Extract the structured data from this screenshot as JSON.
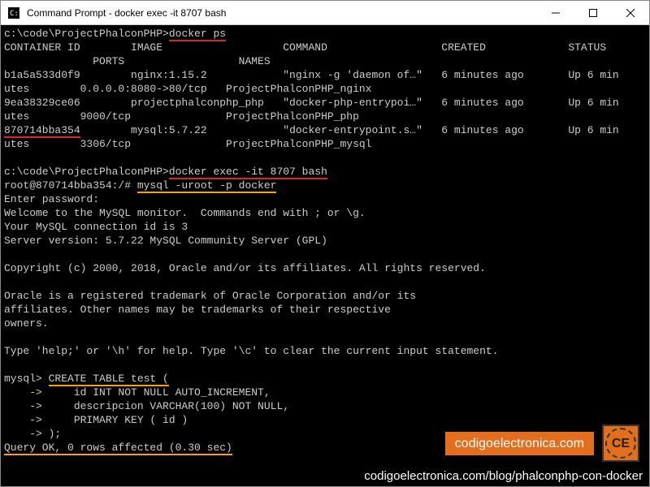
{
  "window": {
    "title": "Command Prompt - docker  exec -it 8707 bash"
  },
  "term": {
    "prompt1_path": "c:\\code\\ProjectPhalconPHP>",
    "cmd_dockerps": "docker ps",
    "hdr": "CONTAINER ID        IMAGE                   COMMAND                  CREATED             STATUS",
    "hdr2": "              PORTS                  NAMES",
    "r1a": "b1a5a533d0f9        nginx:1.15.2            \"nginx -g 'daemon of…\"   6 minutes ago       Up 6 min",
    "r1b": "utes        0.0.0.0:8080->80/tcp   ProjectPhalconPHP_nginx",
    "r2a": "9ea38329ce06        projectphalconphp_php   \"docker-php-entrypoi…\"   6 minutes ago       Up 6 min",
    "r2b": "utes        9000/tcp               ProjectPhalconPHP_php",
    "r3a_id": "870714bba354",
    "r3a_rest": "        mysql:5.7.22            \"docker-entrypoint.s…\"   6 minutes ago       Up 6 min",
    "r3b": "utes        3306/tcp               ProjectPhalconPHP_mysql",
    "blank": " ",
    "prompt2_path": "c:\\code\\ProjectPhalconPHP>",
    "cmd_exec": "docker exec -it 8707 bash",
    "rootprompt": "root@870714bba354:/# ",
    "cmd_mysql": "mysql -uroot -p docker",
    "enterpw": "Enter password:",
    "welcome1": "Welcome to the MySQL monitor.  Commands end with ; or \\g.",
    "welcome2": "Your MySQL connection id is 3",
    "welcome3": "Server version: 5.7.22 MySQL Community Server (GPL)",
    "copyright": "Copyright (c) 2000, 2018, Oracle and/or its affiliates. All rights reserved.",
    "trade1": "Oracle is a registered trademark of Oracle Corporation and/or its",
    "trade2": "affiliates. Other names may be trademarks of their respective",
    "trade3": "owners.",
    "help": "Type 'help;' or '\\h' for help. Type '\\c' to clear the current input statement.",
    "mysqlprompt": "mysql> ",
    "sql_create": "CREATE TABLE test (",
    "sql_l2": "    ->     id INT NOT NULL AUTO_INCREMENT,",
    "sql_l3": "    ->     descripcion VARCHAR(100) NOT NULL,",
    "sql_l4": "    ->     PRIMARY KEY ( id )",
    "sql_l5": "    -> );",
    "queryok": "Query OK, 0 rows affected (0.30 sec)"
  },
  "badge": {
    "site": "codigoelectronica.com",
    "logo": "CE"
  },
  "footer": {
    "url": "codigoelectronica.com/blog/phalconphp-con-docker"
  }
}
